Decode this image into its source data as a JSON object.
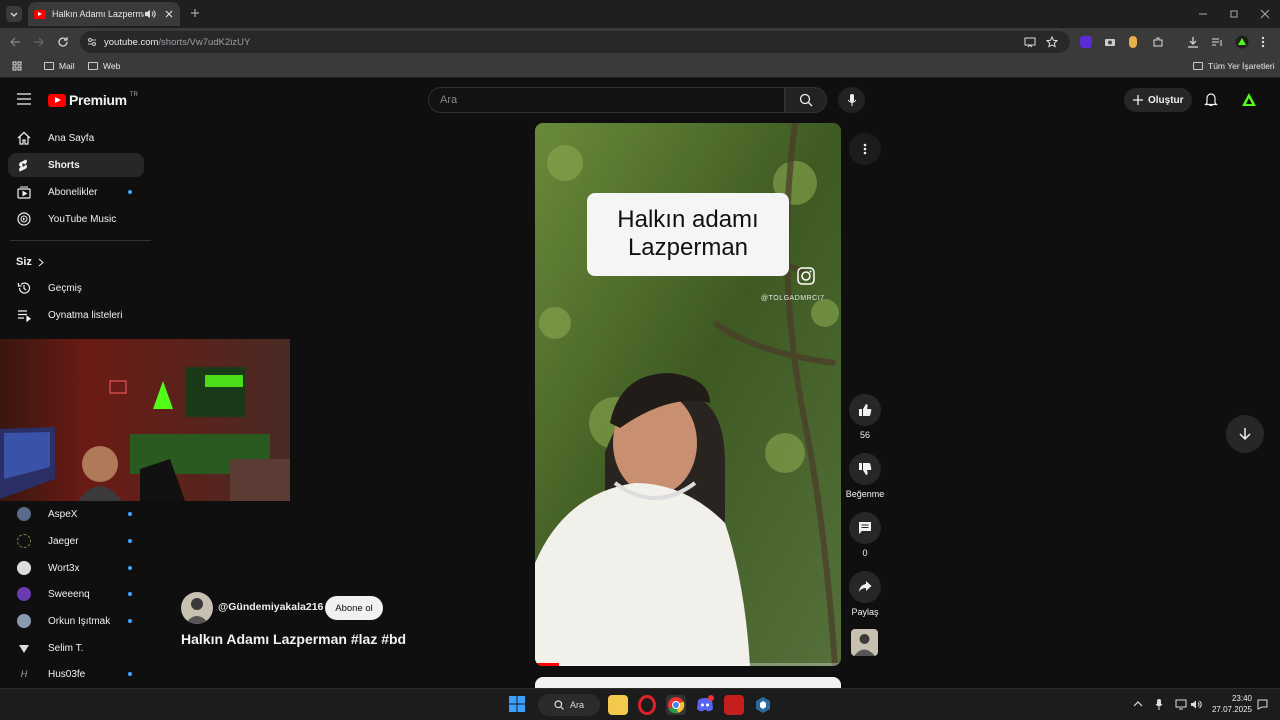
{
  "browser": {
    "tab_title": "Halkın Adamı Lazperman #laz #bd",
    "url_host": "youtube.com",
    "url_path": "/shorts/Vw7udK2izUY",
    "bookmarks": [
      "Mail",
      "Web"
    ],
    "all_bookmarks": "Tüm Yer İşaretleri"
  },
  "youtube": {
    "logo_text": "Premium",
    "logo_badge": "TR",
    "search_placeholder": "Ara",
    "create_label": "Oluştur",
    "nav": [
      {
        "label": "Ana Sayfa"
      },
      {
        "label": "Shorts"
      },
      {
        "label": "Abonelikler"
      },
      {
        "label": "YouTube Music"
      }
    ],
    "you_section": "Siz",
    "you_items": [
      {
        "label": "Geçmiş"
      },
      {
        "label": "Oynatma listeleri"
      }
    ],
    "subscriptions": [
      {
        "label": "AspeX"
      },
      {
        "label": "Jaeger"
      },
      {
        "label": "Wort3x"
      },
      {
        "label": "Sweeenq"
      },
      {
        "label": "Orkun Işıtmak"
      },
      {
        "label": "Selim T."
      },
      {
        "label": "Hus03fe"
      }
    ]
  },
  "short": {
    "overlay_line1": "Halkın adamı",
    "overlay_line2": "Lazperman",
    "watermark": "@TOLGADMRCI7",
    "channel": "@Gündemiyakala216",
    "subscribe_label": "Abone ol",
    "title": "Halkın Adamı Lazperman #laz #bd",
    "likes": "56",
    "dislike_label": "Beğenme",
    "comments": "0",
    "share_label": "Paylaş"
  },
  "taskbar": {
    "search_label": "Ara",
    "time": "23:40",
    "date": "27.07.2025"
  },
  "colors": {
    "accent": "#ff0000",
    "dot": "#3ea6ff",
    "kick_green": "#53fc18"
  }
}
